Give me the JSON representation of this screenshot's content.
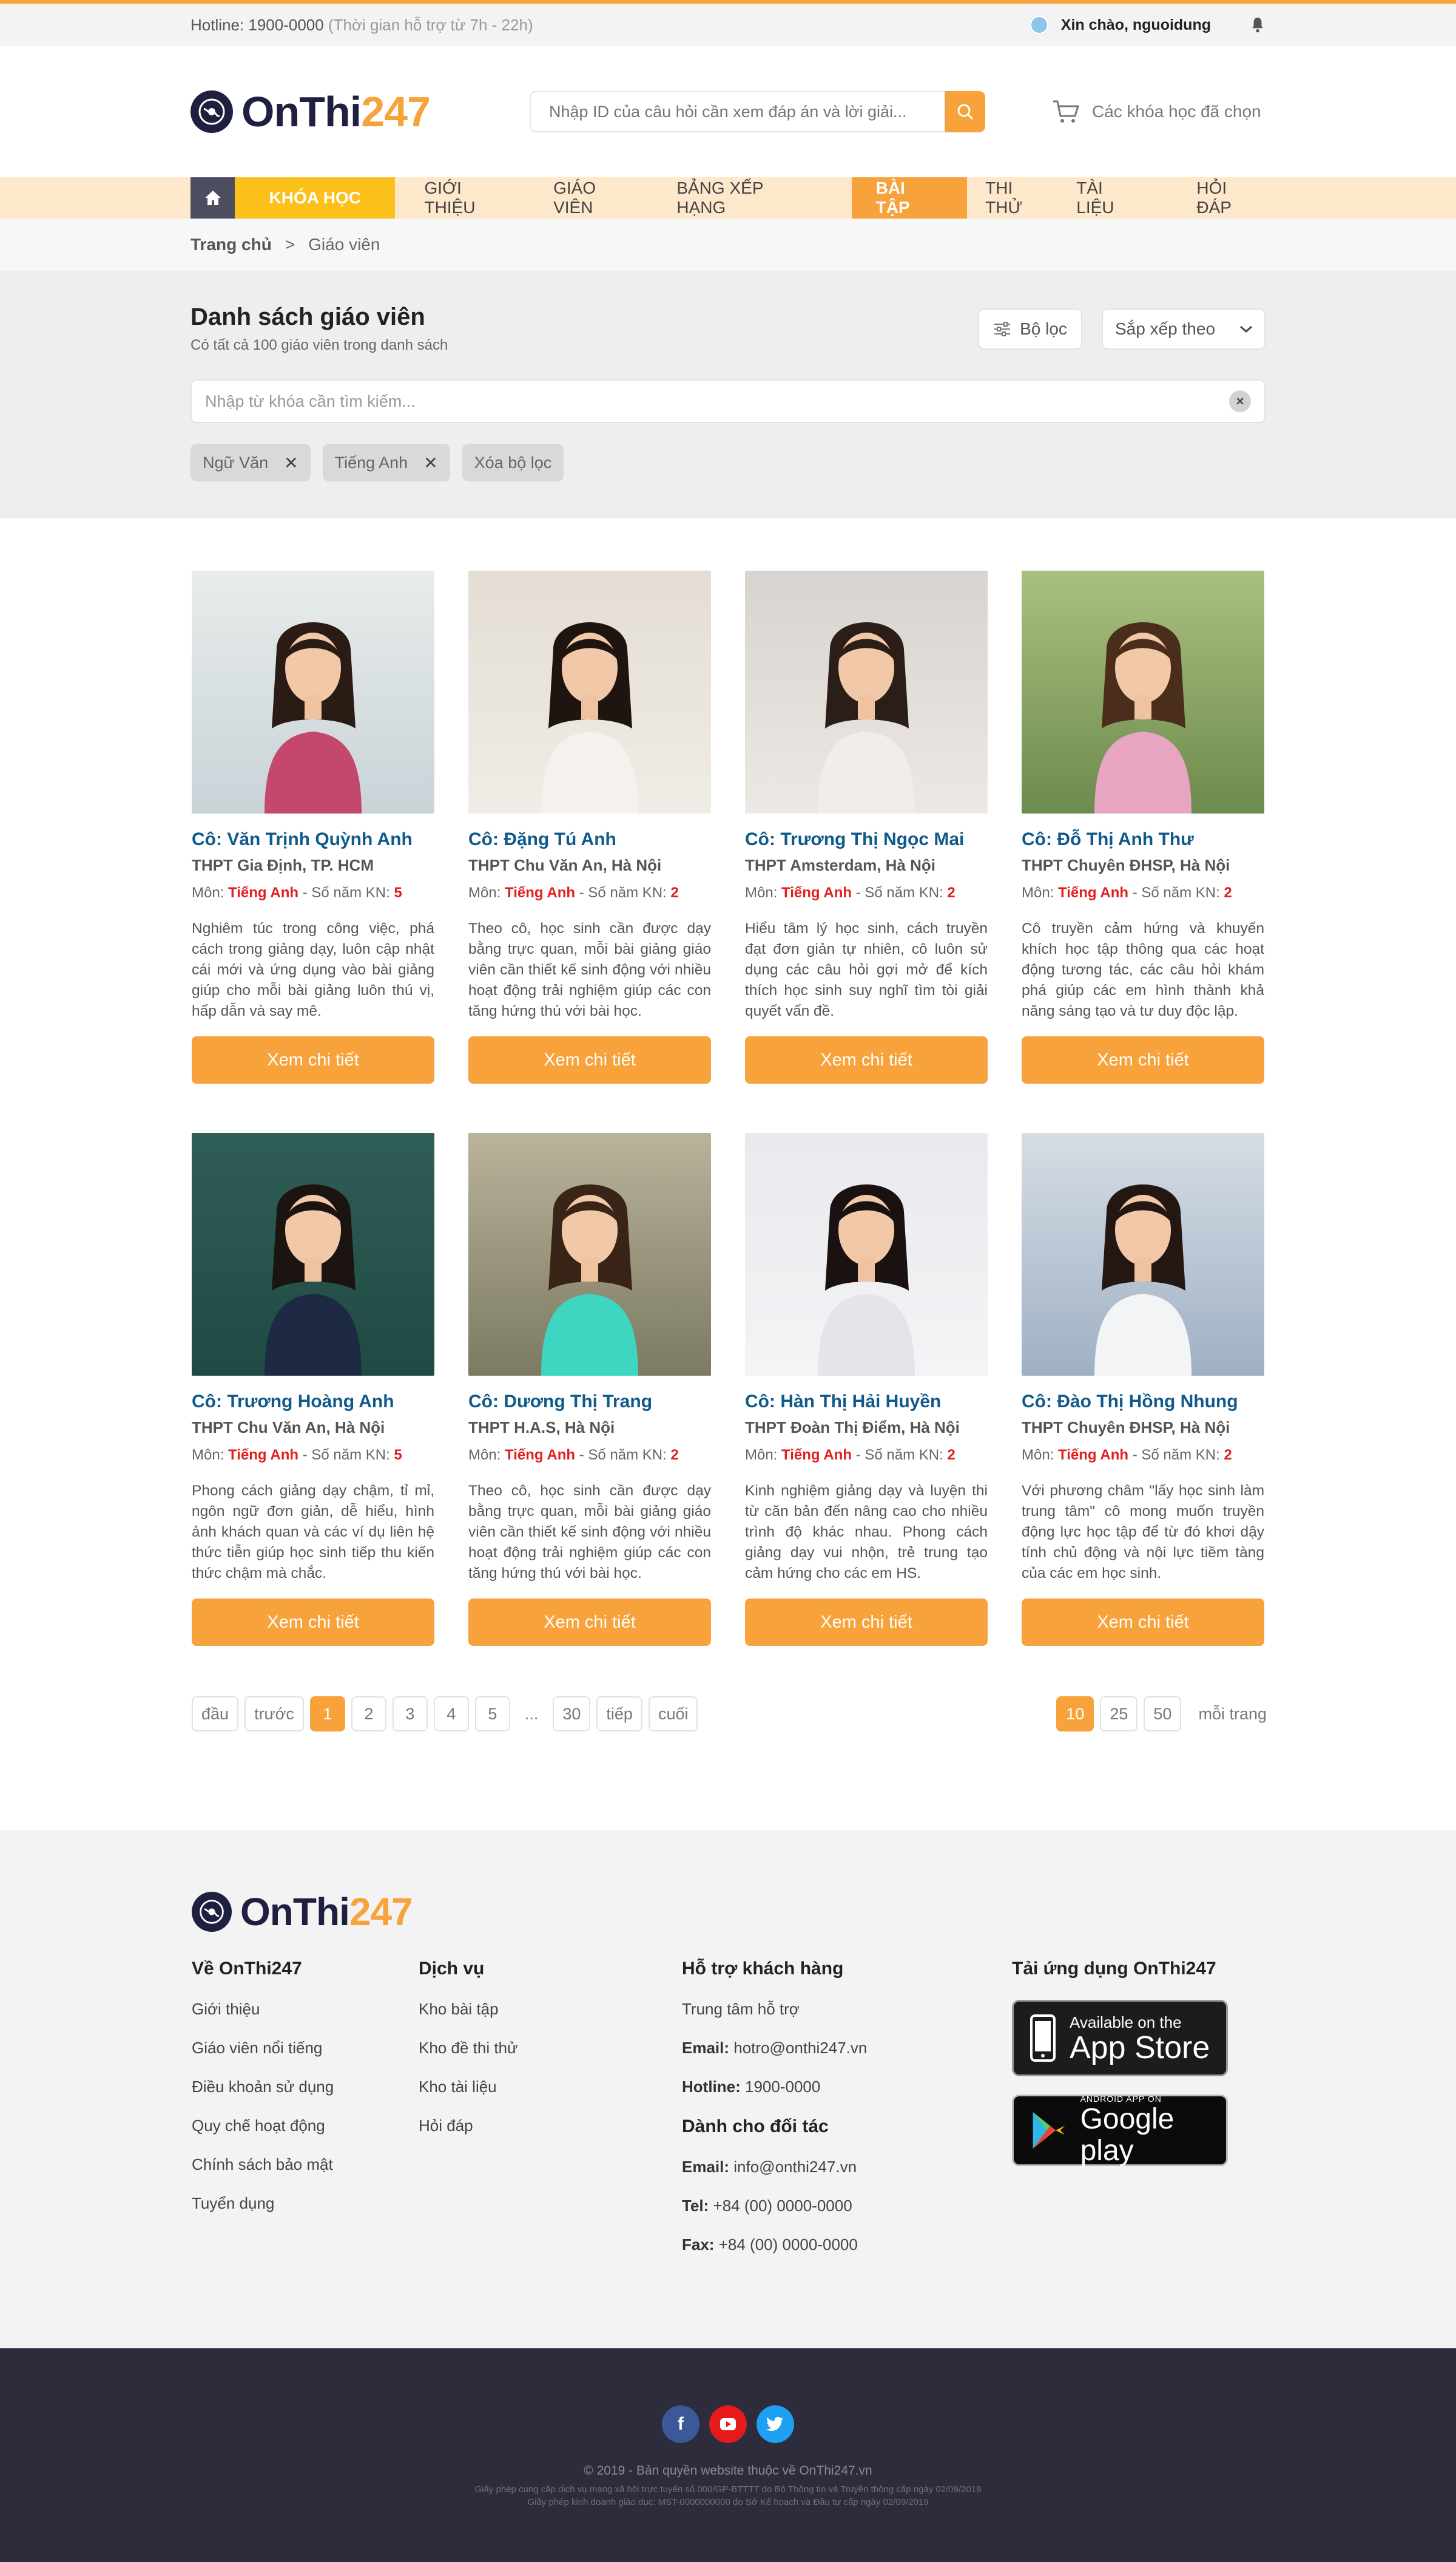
{
  "topbar": {
    "hotline": "Hotline: 1900-0000",
    "hotline_hours": "(Thời gian hỗ trợ từ 7h - 22h)",
    "greeting": "Xin chào, nguoidung"
  },
  "header": {
    "logo_main": "OnThi",
    "logo_num": "247",
    "search_placeholder": "Nhập ID của câu hỏi cần xem đáp án và lời giải...",
    "cart_label": "Các khóa học đã chọn"
  },
  "nav": {
    "course": "KHÓA HỌC",
    "items": [
      "GIỚI THIỆU",
      "GIÁO VIÊN",
      "BẢNG XẾP HẠNG",
      "BÀI TẬP",
      "THI THỬ",
      "TÀI LIỆU",
      "HỎI ĐÁP"
    ]
  },
  "breadcrumb": {
    "home": "Trang chủ",
    "sep": ">",
    "current": "Giáo viên"
  },
  "list": {
    "title": "Danh sách giáo viên",
    "subtitle": "Có tất cả 100 giáo viên trong danh sách",
    "filter_label": "Bộ lọc",
    "sort_label": "Sắp xếp theo",
    "keyword_placeholder": "Nhập từ khóa cần tìm kiếm...",
    "tags": [
      "Ngữ Văn",
      "Tiếng Anh"
    ],
    "clear_filter": "Xóa bộ lọc"
  },
  "card_labels": {
    "subject_prefix": "Môn:",
    "years_prefix": "- Số năm KN:",
    "button": "Xem chi tiết"
  },
  "teachers": [
    {
      "name": "Cô: Văn Trịnh Quỳnh Anh",
      "school": "THPT Gia Định, TP. HCM",
      "subject": "Tiếng Anh",
      "years": "5",
      "desc": "Nghiêm túc trong công việc, phá cách trong giảng dạy, luôn cập nhật cái mới và ứng dụng vào bài giảng giúp cho mỗi bài giảng luôn thú vị, hấp dẫn và say mê."
    },
    {
      "name": "Cô: Đặng Tú Anh",
      "school": "THPT Chu Văn An, Hà Nội",
      "subject": "Tiếng Anh",
      "years": "2",
      "desc": "Theo cô, học sinh cần được dạy bằng trực quan, mỗi bài giảng giáo viên cần thiết kế sinh động với nhiều hoạt động trải nghiệm giúp các con tăng hứng thú với bài học."
    },
    {
      "name": "Cô: Trương Thị Ngọc Mai",
      "school": "THPT Amsterdam, Hà Nội",
      "subject": "Tiếng Anh",
      "years": "2",
      "desc": "Hiểu tâm lý học sinh, cách truyền đạt đơn giản tự nhiên, cô luôn sử dụng các câu hỏi gợi mở để kích thích học sinh suy nghĩ tìm tòi giải quyết vấn đề."
    },
    {
      "name": "Cô: Đỗ Thị Anh Thư",
      "school": "THPT Chuyên ĐHSP, Hà Nội",
      "subject": "Tiếng Anh",
      "years": "2",
      "desc": "Cô truyền cảm hứng và khuyến khích học tập thông qua các hoạt động tương tác, các câu hỏi khám phá giúp các em hình thành khả năng sáng tạo và tư duy độc lập."
    },
    {
      "name": "Cô: Trương Hoàng Anh",
      "school": "THPT Chu Văn An, Hà Nội",
      "subject": "Tiếng Anh",
      "years": "5",
      "desc": "Phong cách giảng dạy chậm, tỉ mỉ, ngôn ngữ đơn giản, dễ hiểu, hình ảnh khách quan và các ví dụ liên hệ thức tiễn giúp học sinh tiếp thu kiến thức chậm mà chắc."
    },
    {
      "name": "Cô: Dương Thị Trang",
      "school": "THPT H.A.S, Hà Nội",
      "subject": "Tiếng Anh",
      "years": "2",
      "desc": "Theo cô, học sinh cần được dạy bằng trực quan, mỗi bài giảng giáo viên cần thiết kế sinh động với nhiều hoạt động trải nghiệm giúp các con tăng hứng thú với bài học."
    },
    {
      "name": "Cô: Hàn Thị Hải Huyền",
      "school": "THPT Đoàn Thị Điểm, Hà Nội",
      "subject": "Tiếng Anh",
      "years": "2",
      "desc": "Kinh nghiệm giảng dạy và luyện thi từ căn bản đến nâng cao cho nhiều trình độ khác nhau. Phong cách giảng dạy vui nhộn, trẻ trung tạo cảm hứng cho các em HS."
    },
    {
      "name": "Cô: Đào Thị Hồng Nhung",
      "school": "THPT Chuyên ĐHSP, Hà Nội",
      "subject": "Tiếng Anh",
      "years": "2",
      "desc": "Với phương châm \"lấy học sinh làm trung tâm\" cô mong muốn truyền động lực học tập để từ đó khơi dậy tính chủ động và nội lực tiềm tàng của các em học sinh."
    }
  ],
  "pagination": {
    "first": "đầu",
    "prev": "trước",
    "pages": [
      "1",
      "2",
      "3",
      "4",
      "5"
    ],
    "ellipsis": "...",
    "last_page": "30",
    "next": "tiếp",
    "last": "cuối",
    "current": "1",
    "per_page": [
      "10",
      "25",
      "50"
    ],
    "per_page_selected": "10",
    "per_page_label": "mỗi trang"
  },
  "footer": {
    "about": {
      "title": "Về OnThi247",
      "items": [
        "Giới thiệu",
        "Giáo viên nổi tiếng",
        "Điều khoản sử dụng",
        "Quy chế hoạt động",
        "Chính sách bảo mật",
        "Tuyển dụng"
      ]
    },
    "services": {
      "title": "Dịch vụ",
      "items": [
        "Kho bài tập",
        "Kho đề thi thử",
        "Kho tài liệu",
        "Hỏi đáp"
      ]
    },
    "support": {
      "title": "Hỗ trợ khách hàng",
      "center": "Trung tâm hỗ trợ",
      "email_label": "Email:",
      "email": "hotro@onthi247.vn",
      "hotline_label": "Hotline:",
      "hotline": "1900-0000"
    },
    "partners": {
      "title": "Dành cho đối tác",
      "email_label": "Email:",
      "email": "info@onthi247.vn",
      "tel_label": "Tel:",
      "tel": "+84 (00) 0000-0000",
      "fax_label": "Fax:",
      "fax": "+84 (00) 0000-0000"
    },
    "apps": {
      "title": "Tải ứng dụng OnThi247",
      "appstore_small": "Available on the",
      "appstore_big": "App Store",
      "gplay_small": "ANDROID APP ON",
      "gplay_big": "Google play"
    }
  },
  "bottom": {
    "copyright": "© 2019 - Bản quyền website thuộc về OnThi247.vn",
    "license1": "Giấy phép cung cấp dịch vụ mạng xã hội trực tuyến số 000/GP-BTTTT do Bộ Thông tin và Truyền thông cấp ngày 02/09/2019",
    "license2": "Giấy phép kinh doanh giáo dục: MST-0000000000 do Sở Kế hoạch và Đầu tư cấp ngày 02/09/2019"
  },
  "colors": {
    "accent": "#f7a23a",
    "nav_bg": "#fde8cb",
    "course_yellow": "#fbc019",
    "name_blue": "#0f5a8a",
    "footer_dark": "#2d2c3d"
  }
}
